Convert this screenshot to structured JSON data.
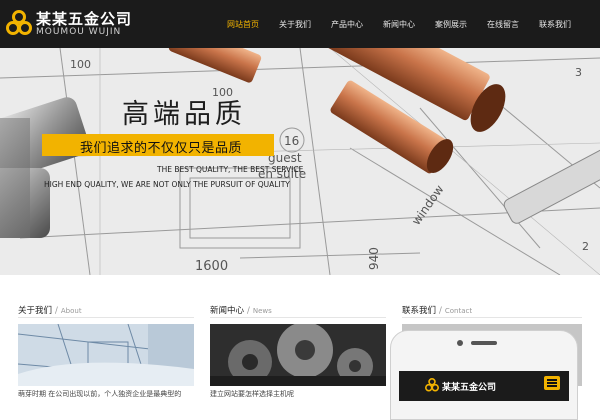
{
  "header": {
    "logo_title": "某某五金公司",
    "logo_subtitle": "MOUMOU WUJIN",
    "accent_color": "#f2b300",
    "nav": [
      {
        "label": "网站首页",
        "active": true
      },
      {
        "label": "关于我们",
        "active": false
      },
      {
        "label": "产品中心",
        "active": false
      },
      {
        "label": "新闻中心",
        "active": false
      },
      {
        "label": "案例展示",
        "active": false
      },
      {
        "label": "在线留言",
        "active": false
      },
      {
        "label": "联系我们",
        "active": false
      }
    ]
  },
  "hero": {
    "title": "高端品质",
    "ribbon": "我们追求的不仅仅只是品质",
    "subtitle_1": "THE BEST QUALITY, THE BEST SERVICE",
    "subtitle_2": "HIGH END QUALITY, WE ARE NOT ONLY THE PURSUIT OF QUALITY",
    "blueprint_labels": [
      "100",
      "100",
      "16",
      "guest",
      "en suite",
      "window",
      "1600",
      "940",
      "3",
      "2"
    ]
  },
  "sections": {
    "about": {
      "title": "关于我们",
      "en": "About",
      "text": "萌芽时期  在公司出现以前，个人独资企业是最典型的"
    },
    "news": {
      "title": "新闻中心",
      "en": "News",
      "text": "建立网站要怎样选择主机呢"
    },
    "contact": {
      "title": "联系我们",
      "en": "Contact"
    }
  },
  "phone": {
    "logo_title": "某某五金公司"
  }
}
